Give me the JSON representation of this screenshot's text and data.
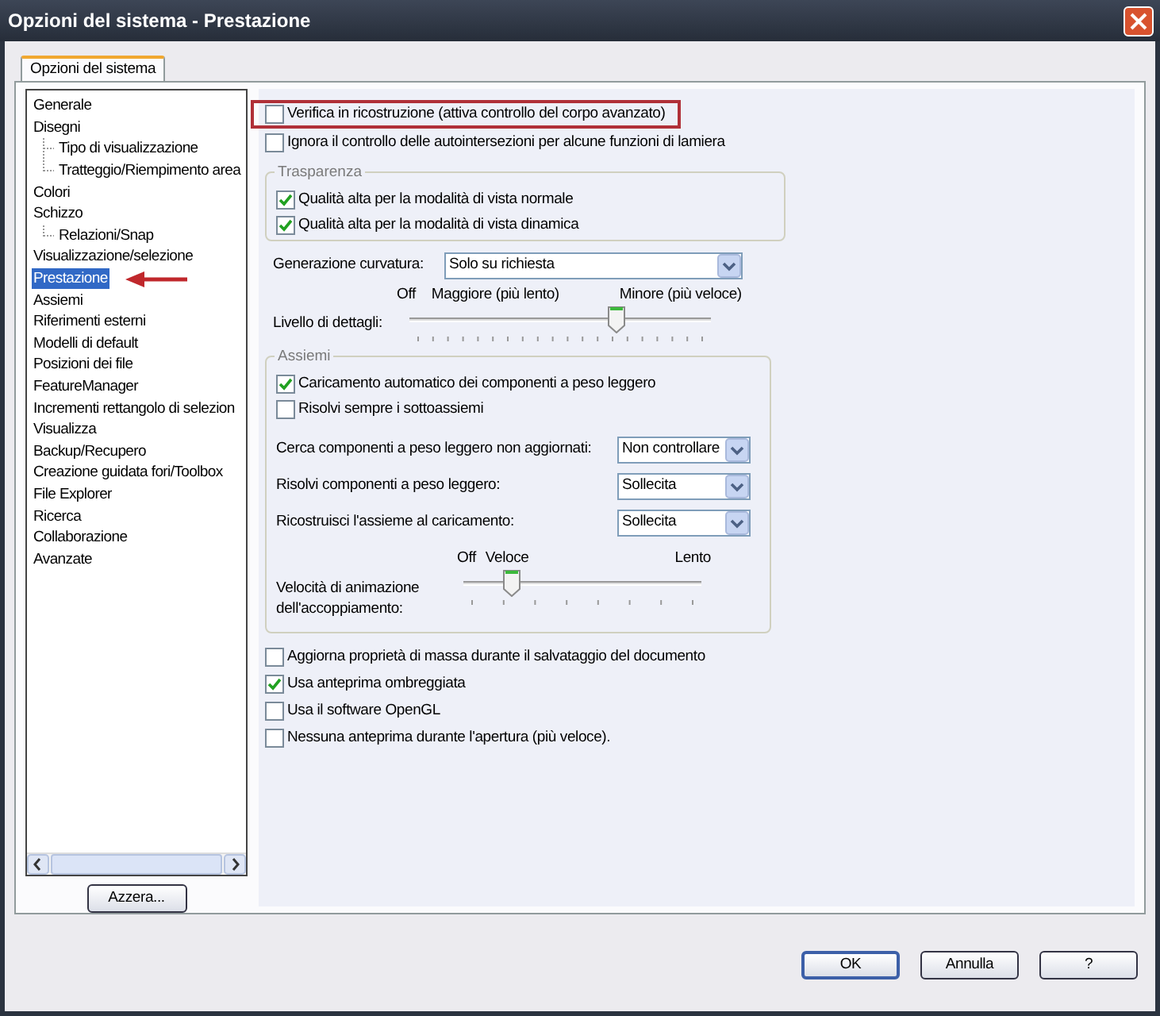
{
  "window": {
    "title": "Opzioni del sistema - Prestazione"
  },
  "tabs": [
    {
      "label": "Opzioni del sistema",
      "selected": true
    }
  ],
  "tree": {
    "items": [
      {
        "label": "Generale",
        "selected": false,
        "marked": false
      },
      {
        "label": "Disegni",
        "selected": false,
        "marked": false,
        "children": [
          {
            "label": "Tipo di visualizzazione",
            "selected": false,
            "marked": false
          },
          {
            "label": "Tratteggio/Riempimento area",
            "selected": false,
            "marked": false
          }
        ]
      },
      {
        "label": "Colori",
        "selected": false,
        "marked": false
      },
      {
        "label": "Schizzo",
        "selected": false,
        "marked": false,
        "children": [
          {
            "label": "Relazioni/Snap",
            "selected": false,
            "marked": false
          }
        ]
      },
      {
        "label": "Visualizzazione/selezione",
        "selected": false,
        "marked": false
      },
      {
        "label": "Prestazione",
        "selected": true,
        "marked": true
      },
      {
        "label": "Assiemi",
        "selected": false,
        "marked": false
      },
      {
        "label": "Riferimenti esterni",
        "selected": false,
        "marked": false
      },
      {
        "label": "Modelli di default",
        "selected": false,
        "marked": false
      },
      {
        "label": "Posizioni dei file",
        "selected": false,
        "marked": false
      },
      {
        "label": "FeatureManager",
        "selected": false,
        "marked": false
      },
      {
        "label": "Incrementi rettangolo di selezion",
        "selected": false,
        "marked": false
      },
      {
        "label": "Visualizza",
        "selected": false,
        "marked": false
      },
      {
        "label": "Backup/Recupero",
        "selected": false,
        "marked": false
      },
      {
        "label": "Creazione guidata fori/Toolbox",
        "selected": false,
        "marked": false
      },
      {
        "label": "File Explorer",
        "selected": false,
        "marked": false
      },
      {
        "label": "Ricerca",
        "selected": false,
        "marked": false
      },
      {
        "label": "Collaborazione",
        "selected": false,
        "marked": false
      },
      {
        "label": "Avanzate",
        "selected": false,
        "marked": false
      }
    ]
  },
  "reset_button": "Azzera...",
  "top_checks": [
    {
      "label": "Verifica in ricostruzione (attiva controllo del corpo avanzato)",
      "checked": false,
      "highlighted": true
    },
    {
      "label": "Ignora il controllo delle autointersezioni per alcune funzioni di lamiera",
      "checked": false,
      "highlighted": false
    }
  ],
  "transparency": {
    "title": "Trasparenza",
    "checks": [
      {
        "label": "Qualità alta per la modalità di vista normale",
        "checked": true
      },
      {
        "label": "Qualità alta per la modalità di vista dinamica",
        "checked": true
      }
    ]
  },
  "curvature": {
    "label": "Generazione curvatura:",
    "value": "Solo su richiesta"
  },
  "detail": {
    "label": "Livello di dettagli:",
    "scale_labels": [
      "Off",
      "Maggiore (più lento)",
      "Minore (più veloce)"
    ],
    "level": 0.7
  },
  "assemblies": {
    "title": "Assiemi",
    "checks": [
      {
        "label": "Caricamento automatico dei componenti a peso leggero",
        "checked": true
      },
      {
        "label": "Risolvi sempre i sottoassiemi",
        "checked": false
      }
    ],
    "dropdowns": [
      {
        "label": "Cerca componenti a peso leggero non aggiornati:",
        "value": "Non controllare"
      },
      {
        "label": "Risolvi componenti a peso leggero:",
        "value": "Sollecita"
      },
      {
        "label": "Ricostruisci l'assieme al caricamento:",
        "value": "Sollecita"
      }
    ],
    "animation": {
      "label": "Velocità di animazione dell'accoppiamento:",
      "scale_labels": [
        "Off",
        "Veloce",
        "Lento"
      ],
      "level": 0.18
    }
  },
  "bottom_checks": [
    {
      "label": "Aggiorna proprietà di massa durante il salvataggio del documento",
      "checked": false
    },
    {
      "label": "Usa anteprima ombreggiata",
      "checked": true
    },
    {
      "label": "Usa il software OpenGL",
      "checked": false
    },
    {
      "label": "Nessuna anteprima durante l'apertura (più veloce).",
      "checked": false
    }
  ],
  "buttons": [
    {
      "label": "OK",
      "default": true
    },
    {
      "label": "Annulla",
      "default": false
    },
    {
      "label": "?",
      "default": false
    }
  ]
}
